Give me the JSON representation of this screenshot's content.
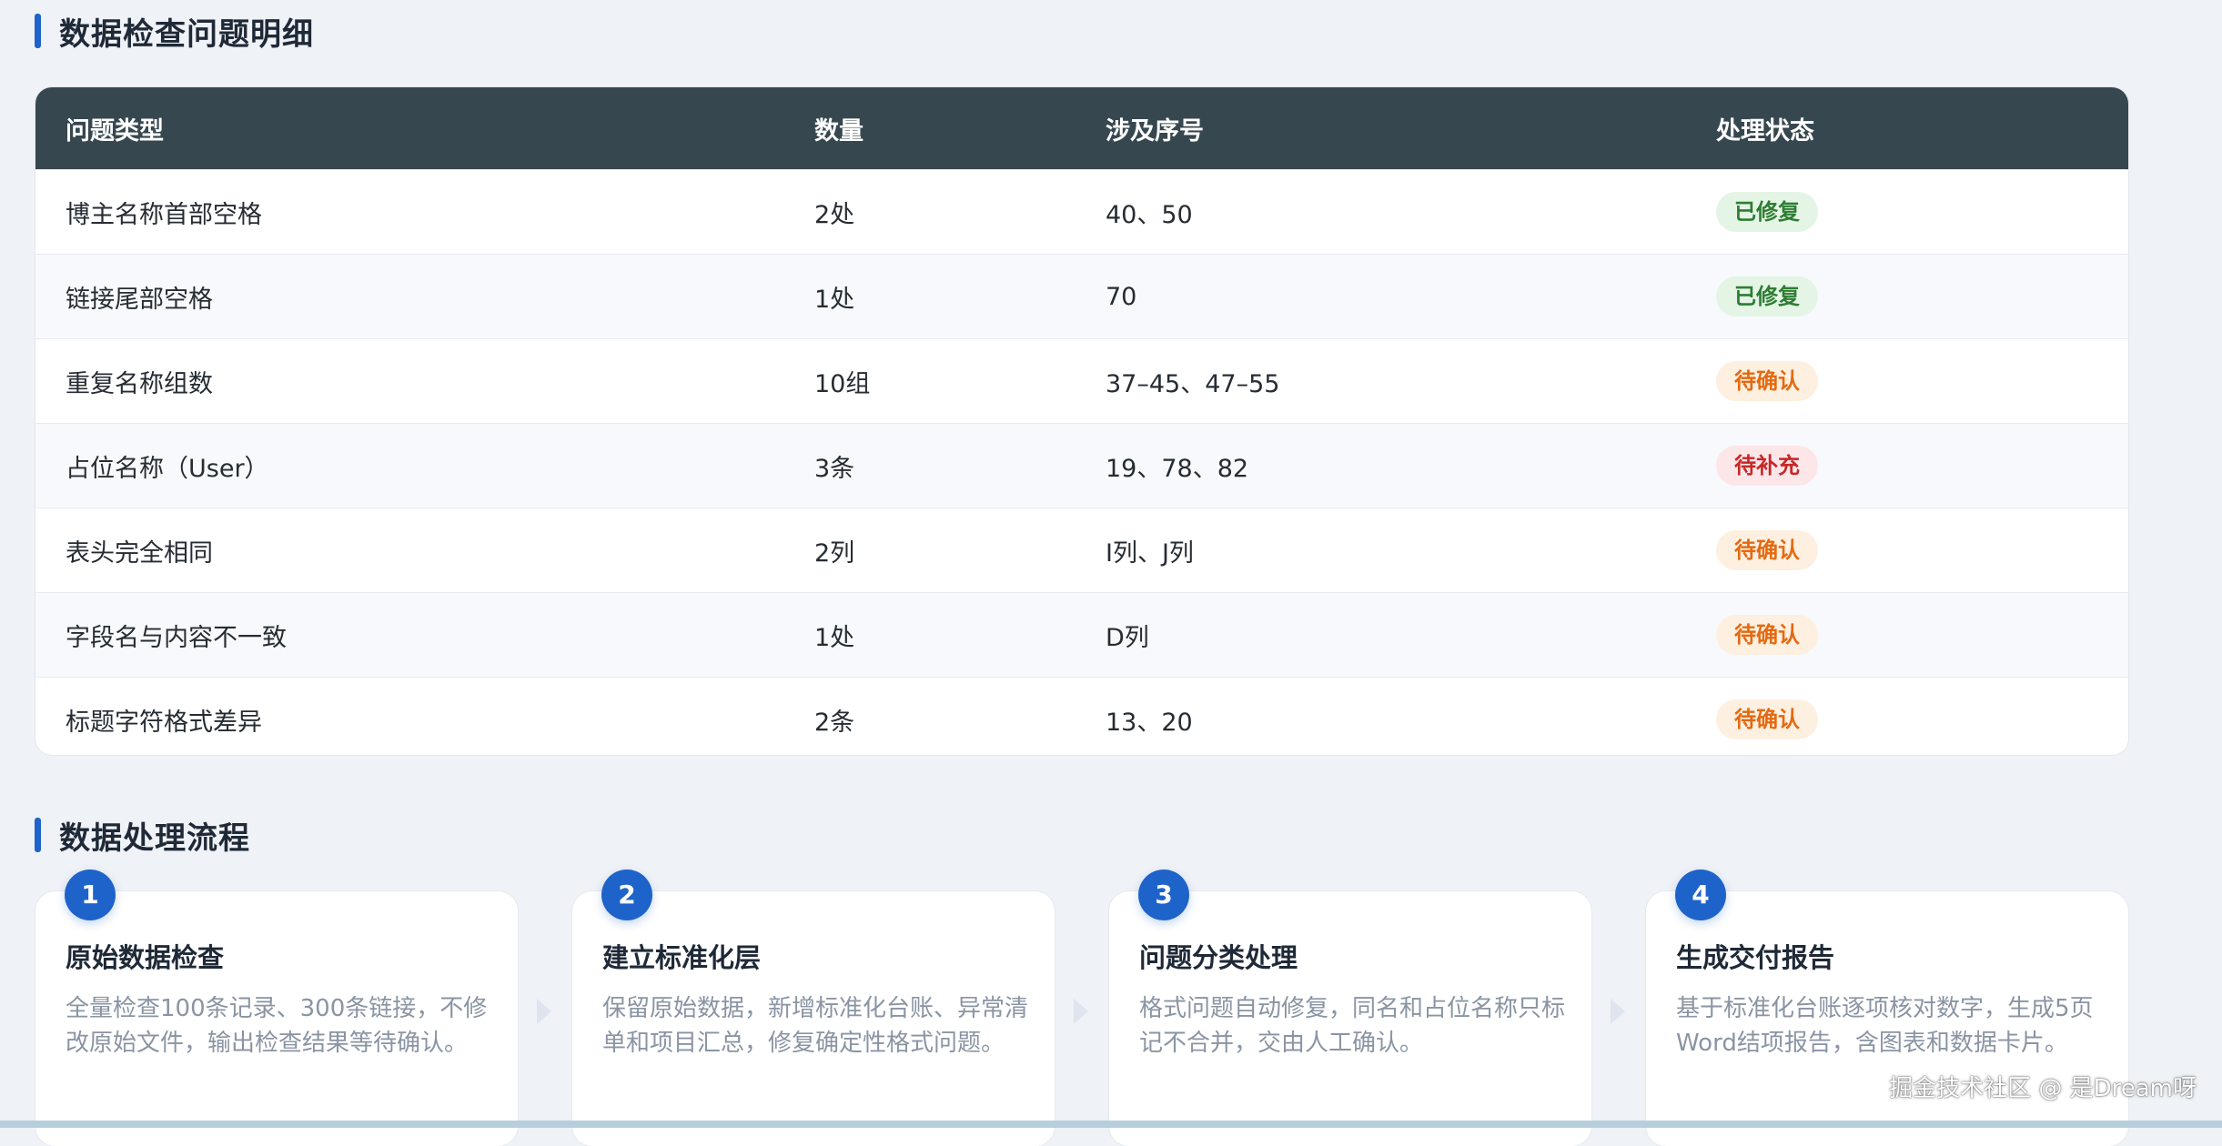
{
  "section1": {
    "title": "数据检查问题明细"
  },
  "table": {
    "headers": [
      "问题类型",
      "数量",
      "涉及序号",
      "处理状态"
    ],
    "rows": [
      {
        "type": "博主名称首部空格",
        "count": "2处",
        "ids": "40、50",
        "status": "已修复"
      },
      {
        "type": "链接尾部空格",
        "count": "1处",
        "ids": "70",
        "status": "已修复"
      },
      {
        "type": "重复名称组数",
        "count": "10组",
        "ids": "37–45、47–55",
        "status": "待确认"
      },
      {
        "type": "占位名称（User）",
        "count": "3条",
        "ids": "19、78、82",
        "status": "待补充"
      },
      {
        "type": "表头完全相同",
        "count": "2列",
        "ids": "I列、J列",
        "status": "待确认"
      },
      {
        "type": "字段名与内容不一致",
        "count": "1处",
        "ids": "D列",
        "status": "待确认"
      },
      {
        "type": "标题字符格式差异",
        "count": "2条",
        "ids": "13、20",
        "status": "待确认"
      }
    ]
  },
  "section2": {
    "title": "数据处理流程"
  },
  "steps": [
    {
      "num": "1",
      "title": "原始数据检查",
      "desc": "全量检查100条记录、300条链接，不修改原始文件，输出检查结果等待确认。"
    },
    {
      "num": "2",
      "title": "建立标准化层",
      "desc": "保留原始数据，新增标准化台账、异常清单和项目汇总，修复确定性格式问题。"
    },
    {
      "num": "3",
      "title": "问题分类处理",
      "desc": "格式问题自动修复，同名和占位名称只标记不合并，交由人工确认。"
    },
    {
      "num": "4",
      "title": "生成交付报告",
      "desc": "基于标准化台账逐项核对数字，生成5页Word结项报告，含图表和数据卡片。"
    }
  ],
  "watermark": "掘金技术社区 @ 是Dream呀",
  "colors": {
    "accent": "#1e63c9",
    "header_bg": "#37474f",
    "status_fixed": "#2e7d32",
    "status_confirm": "#e36a12",
    "status_supply": "#c62828"
  }
}
